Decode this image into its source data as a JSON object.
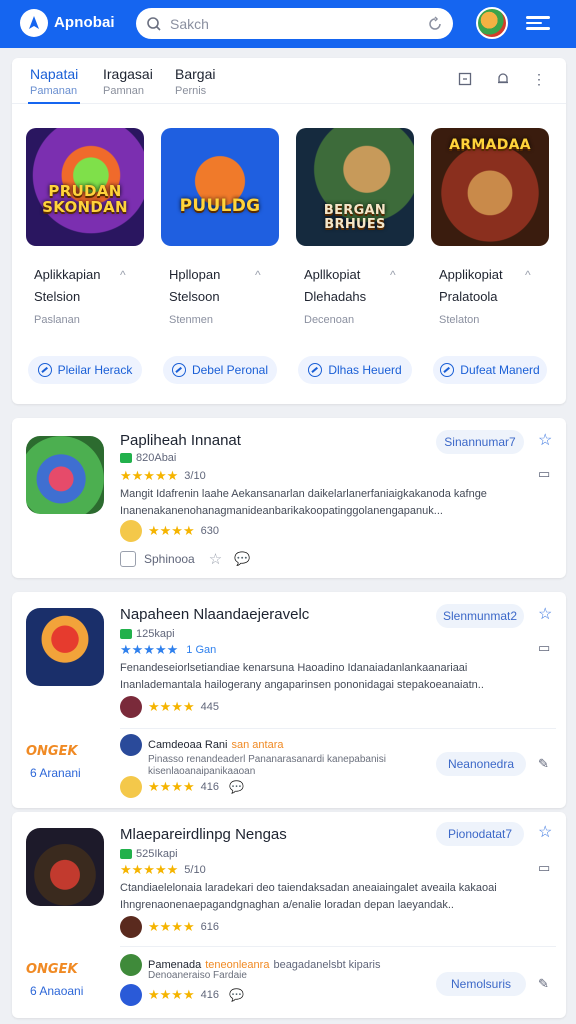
{
  "header": {
    "app_title": "Apnobai",
    "search_placeholder": "Sakch",
    "brand_color": "#1565f0"
  },
  "tabs": [
    {
      "title": "Napatai",
      "subtitle": "Pamanan"
    },
    {
      "title": "Iragasai",
      "subtitle": "Pamnan"
    },
    {
      "title": "Bargai",
      "subtitle": "Pernis"
    }
  ],
  "featured": [
    {
      "thumb_text": "PRUDAN SKONDAN",
      "name_line1": "Aplikkapian",
      "name_line2": "Stelsion",
      "sub": "Paslanan",
      "button": "Pleilar Herack"
    },
    {
      "thumb_text": "PUULDG",
      "name_line1": "Hpllopan",
      "name_line2": "Stelsoon",
      "sub": "Stenmen",
      "button": "Debel Peronal"
    },
    {
      "thumb_text": "BERGAN BRHUES",
      "name_line1": "Apllkopiat",
      "name_line2": "Dlehadahs",
      "sub": "Decenoan",
      "button": "Dlhas Heuerd"
    },
    {
      "thumb_text": "ARMADAA",
      "name_line1": "Applikopiat",
      "name_line2": "Pralatoola",
      "sub": "Stelaton",
      "button": "Dufeat Manerd"
    }
  ],
  "apps": [
    {
      "title": "Papliheah Innanat",
      "meta": "820Abai",
      "rating": "3/10",
      "description": "Mangit Idafrenin laahe Aekansanarlan daikelarlanerfaniaigkakanoda kafnge Inanenakanenohanagmanideanbarikakoopatinggolanengapanuk...",
      "review_rating": "630",
      "action_label": "Sphinooa",
      "pill": "Sinannumar7"
    },
    {
      "title": "Napaheen Nlaandaejeravelc",
      "meta": "125kapi",
      "rating": "1 Gan",
      "description": "Fenandeseiorlsetiandiae kenarsuna Haoadino Idanaiadanlankaanariaai Inanlademantala hailogerany angaparinsen pononidagai stepakoeanaiatn..",
      "review_rating": "445",
      "pill": "Slenmunmat2",
      "sub": {
        "logo_text": "ONGEK",
        "logo_label": "6 Aranani",
        "title": "Camdeoaa Rani",
        "title_highlight": "san antara",
        "description": "Pinasso renandeaderl Pananarasanardi kanepabanisi kisenlaoanaipanikaaoan",
        "rating": "416",
        "pill": "Neanonedra"
      }
    },
    {
      "title": "Mlaepareirdlinpg Nengas",
      "meta": "525Ikapi",
      "rating": "5/10",
      "description": "Ctandiaelelonaia laradekari deo taiendaksadan aneaiaingalet aveaila kakaoai Ihngrenaonenaepagandgnaghan a/enalie loradan depan laeyandak..",
      "review_rating": "616",
      "pill": "Pionodatat7",
      "sub": {
        "logo_text": "ONGEK",
        "logo_label": "6 Anaoani",
        "title": "Pamenada",
        "title_highlight": "teneonleanra",
        "title_rest": "beagadanelsbt kiparis",
        "description": "Denoaneraiso Fardaie",
        "rating": "416",
        "pill": "Nemolsuris"
      }
    }
  ]
}
